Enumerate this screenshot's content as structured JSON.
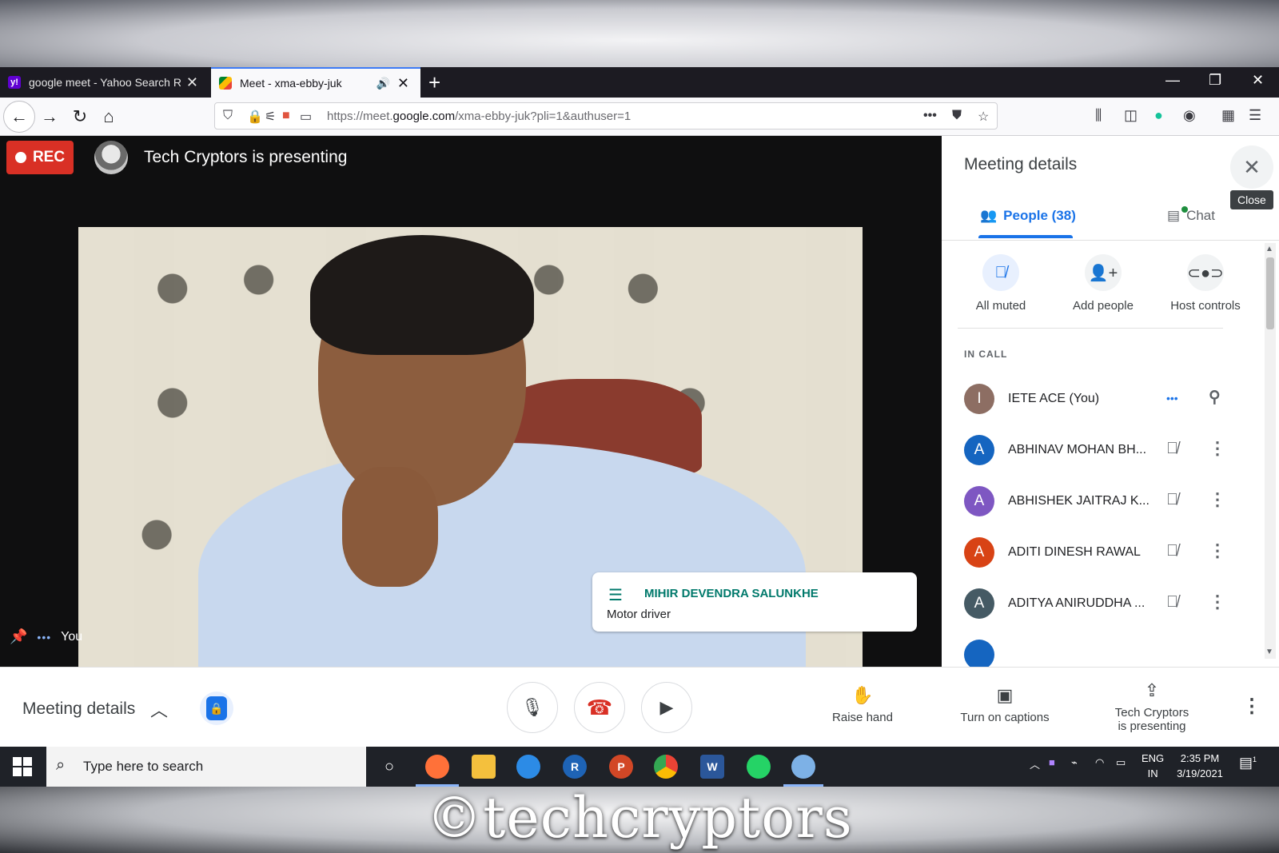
{
  "watermark": "©techcryptors",
  "browser": {
    "tabs": [
      {
        "title": "google meet - Yahoo Search Re",
        "favicon": "yahoo-favicon",
        "active": false
      },
      {
        "title": "Meet - xma-ebby-juk",
        "favicon": "meet-favicon",
        "active": true
      }
    ],
    "url_prefix": "https://meet.",
    "url_domain": "google.com",
    "url_suffix": "/xma-ebby-juk?pli=1&authuser=1"
  },
  "stage": {
    "rec_label": "REC",
    "presenting_text": "Tech Cryptors is presenting",
    "self_label": "You",
    "caption": {
      "speaker": "MIHIR DEVENDRA SALUNKHE",
      "text": "Motor driver"
    }
  },
  "panel": {
    "title": "Meeting details",
    "close_tooltip": "Close",
    "tabs": {
      "people": "People (38)",
      "chat": "Chat"
    },
    "actions": [
      {
        "label": "All muted",
        "icon": "mic-off-icon"
      },
      {
        "label": "Add people",
        "icon": "person-add-icon"
      },
      {
        "label": "Host controls",
        "icon": "toggle-icon"
      }
    ],
    "section_label": "IN CALL",
    "participants": [
      {
        "initial": "I",
        "name": "IETE ACE (You)",
        "color": "#8d6e63"
      },
      {
        "initial": "A",
        "name": "ABHINAV MOHAN BH...",
        "color": "#1565c0"
      },
      {
        "initial": "A",
        "name": "ABHISHEK JAITRAJ K...",
        "color": "#7e57c2"
      },
      {
        "initial": "A",
        "name": "ADITI DINESH RAWAL",
        "color": "#d84315"
      },
      {
        "initial": "A",
        "name": "ADITYA ANIRUDDHA ...",
        "color": "#455a64"
      }
    ]
  },
  "controls": {
    "meeting_details": "Meeting details",
    "raise_hand": "Raise hand",
    "captions": "Turn on captions",
    "present_line1": "Tech Cryptors",
    "present_line2": "is presenting"
  },
  "taskbar": {
    "search_placeholder": "Type here to search",
    "lang_line1": "ENG",
    "lang_line2": "IN",
    "time": "2:35 PM",
    "date": "3/19/2021",
    "notification_count": "1"
  },
  "colors": {
    "accent": "#1a73e8",
    "rec": "#d93025",
    "caption": "#00796b"
  }
}
